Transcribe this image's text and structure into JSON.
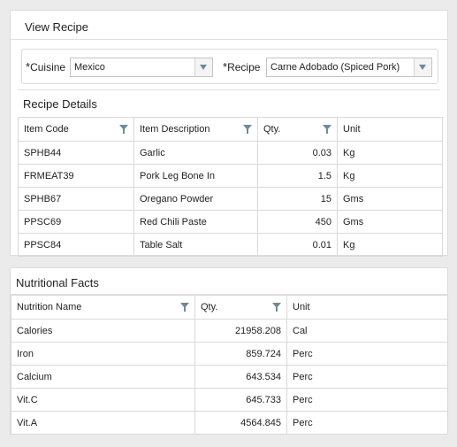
{
  "view_recipe": {
    "title": "View Recipe",
    "cuisine_label": "Cuisine",
    "cuisine_value": "Mexico",
    "recipe_label": "Recipe",
    "recipe_value": "Carne Adobado (Spiced Pork)",
    "required_marker": "*"
  },
  "recipe_details": {
    "title": "Recipe Details",
    "columns": [
      "Item Code",
      "Item Description",
      "Qty.",
      "Unit"
    ],
    "rows": [
      {
        "code": "SPHB44",
        "desc": "Garlic",
        "qty": "0.03",
        "unit": "Kg"
      },
      {
        "code": "FRMEAT39",
        "desc": "Pork Leg Bone In",
        "qty": "1.5",
        "unit": "Kg"
      },
      {
        "code": "SPHB67",
        "desc": "Oregano Powder",
        "qty": "15",
        "unit": "Gms"
      },
      {
        "code": "PPSC69",
        "desc": "Red Chili Paste",
        "qty": "450",
        "unit": "Gms"
      },
      {
        "code": "PPSC84",
        "desc": "Table Salt",
        "qty": "0.01",
        "unit": "Kg"
      }
    ]
  },
  "nutrition": {
    "title": "Nutritional Facts",
    "columns": [
      "Nutrition Name",
      "Qty.",
      "Unit"
    ],
    "rows": [
      {
        "name": "Calories",
        "qty": "21958.208",
        "unit": "Cal"
      },
      {
        "name": "Iron",
        "qty": "859.724",
        "unit": "Perc"
      },
      {
        "name": "Calcium",
        "qty": "643.534",
        "unit": "Perc"
      },
      {
        "name": "Vit.C",
        "qty": "645.733",
        "unit": "Perc"
      },
      {
        "name": "Vit.A",
        "qty": "4564.845",
        "unit": "Perc"
      }
    ]
  },
  "colors": {
    "accent": "#6f8a99",
    "border": "#d9d9d9",
    "background": "#ebebeb"
  },
  "icons": {
    "dropdown": "chevron-down-icon",
    "filter": "filter-icon"
  }
}
